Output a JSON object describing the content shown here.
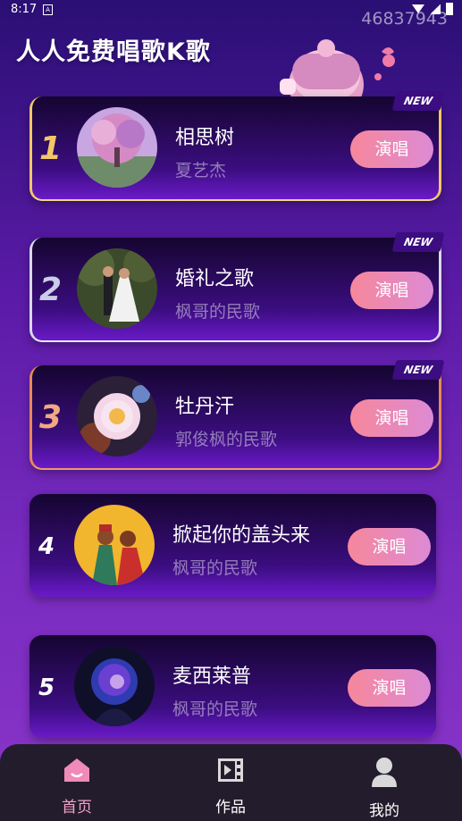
{
  "status_bar": {
    "time": "8:17",
    "notification_icon": "A"
  },
  "watermark": "46837943",
  "app_title": "人人免费唱歌K歌",
  "songs": [
    {
      "rank": "1",
      "title": "相思树",
      "artist": "夏艺杰",
      "button": "演唱",
      "badge": "NEW",
      "cover": "purple-tree"
    },
    {
      "rank": "2",
      "title": "婚礼之歌",
      "artist": "枫哥的民歌",
      "button": "演唱",
      "badge": "NEW",
      "cover": "wedding-couple"
    },
    {
      "rank": "3",
      "title": "牡丹汗",
      "artist": "郭俊枫的民歌",
      "button": "演唱",
      "badge": "NEW",
      "cover": "peony-flower"
    },
    {
      "rank": "4",
      "title": "掀起你的盖头来",
      "artist": "枫哥的民歌",
      "button": "演唱",
      "cover": "dancing-couple"
    },
    {
      "rank": "5",
      "title": "麦西莱普",
      "artist": "枫哥的民歌",
      "button": "演唱",
      "cover": "neon-singer"
    }
  ],
  "bottom_nav": [
    {
      "label": "首页",
      "icon": "home-icon",
      "active": true
    },
    {
      "label": "作品",
      "icon": "film-icon",
      "active": false
    },
    {
      "label": "我的",
      "icon": "user-icon",
      "active": false
    }
  ],
  "colors": {
    "button_start": "#f6879b",
    "button_end": "#dd8ad5",
    "gold": "#f3c667",
    "silver": "#c9cde6",
    "bronze": "#f2a882",
    "nav_active": "#f4a3c8"
  }
}
